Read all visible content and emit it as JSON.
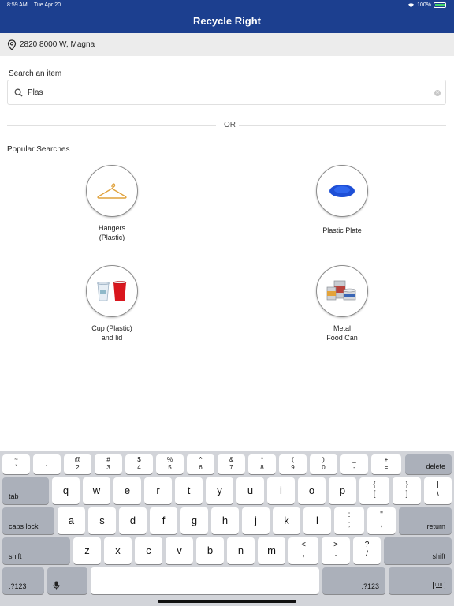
{
  "status_bar": {
    "time": "8:59 AM",
    "date": "Tue Apr 20",
    "battery": "100%"
  },
  "app": {
    "title": "Recycle Right"
  },
  "location": {
    "address": "2820 8000 W, Magna",
    "icon": "map-pin-icon"
  },
  "search": {
    "label": "Search an item",
    "value": "Plas"
  },
  "divider": {
    "or": "OR"
  },
  "popular": {
    "title": "Popular Searches",
    "items": [
      {
        "line1": "Hangers",
        "line2": "(Plastic)",
        "icon": "hanger-icon"
      },
      {
        "line1": "Plastic Plate",
        "line2": "",
        "icon": "plate-icon"
      },
      {
        "line1": "Cup (Plastic)",
        "line2": "and lid",
        "icon": "cup-icon"
      },
      {
        "line1": "Metal",
        "line2": "Food Can",
        "icon": "food-can-icon"
      }
    ]
  },
  "keyboard": {
    "row0": [
      {
        "top": "~",
        "bot": "`"
      },
      {
        "top": "!",
        "bot": "1"
      },
      {
        "top": "@",
        "bot": "2"
      },
      {
        "top": "#",
        "bot": "3"
      },
      {
        "top": "$",
        "bot": "4"
      },
      {
        "top": "%",
        "bot": "5"
      },
      {
        "top": "^",
        "bot": "6"
      },
      {
        "top": "&",
        "bot": "7"
      },
      {
        "top": "*",
        "bot": "8"
      },
      {
        "top": "(",
        "bot": "9"
      },
      {
        "top": ")",
        "bot": "0"
      },
      {
        "top": "_",
        "bot": "-"
      },
      {
        "top": "+",
        "bot": "="
      }
    ],
    "delete": "delete",
    "tab": "tab",
    "row1": [
      "q",
      "w",
      "e",
      "r",
      "t",
      "y",
      "u",
      "i",
      "o",
      "p"
    ],
    "row1_extra": [
      {
        "top": "{",
        "bot": "["
      },
      {
        "top": "}",
        "bot": "]"
      },
      {
        "top": "|",
        "bot": "\\"
      }
    ],
    "caps_lock": "caps lock",
    "row2": [
      "a",
      "s",
      "d",
      "f",
      "g",
      "h",
      "j",
      "k",
      "l"
    ],
    "row2_extra": [
      {
        "top": ":",
        "bot": ";"
      },
      {
        "top": "\"",
        "bot": ","
      }
    ],
    "return": "return",
    "shift": "shift",
    "row3": [
      "z",
      "x",
      "c",
      "v",
      "b",
      "n",
      "m"
    ],
    "row3_extra": [
      {
        "top": "<",
        "bot": ","
      },
      {
        "top": ">",
        "bot": "."
      },
      {
        "top": "?",
        "bot": "/"
      }
    ],
    "numbers_left": ".?123",
    "numbers_right": ".?123"
  }
}
